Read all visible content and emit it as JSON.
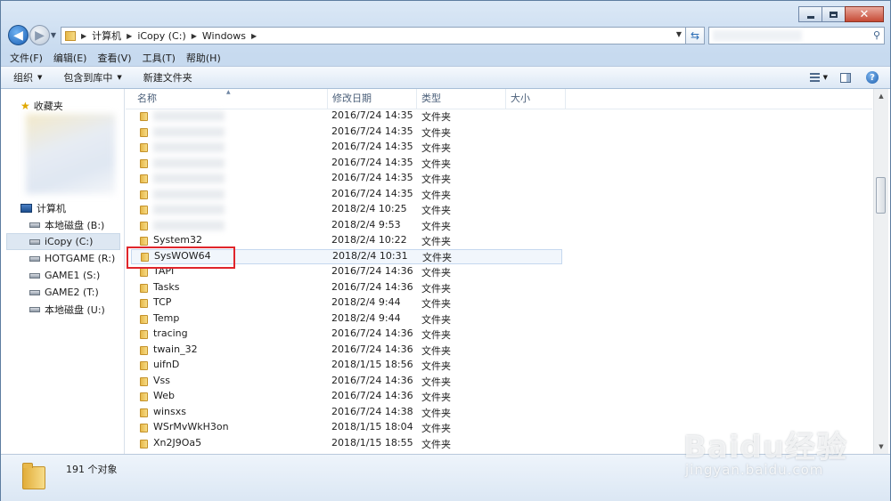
{
  "address": {
    "crumbs": [
      "计算机",
      "iCopy (C:)",
      "Windows"
    ]
  },
  "menu": [
    "文件(F)",
    "编辑(E)",
    "查看(V)",
    "工具(T)",
    "帮助(H)"
  ],
  "commands": {
    "organize": "组织",
    "include_library": "包含到库中",
    "new_folder": "新建文件夹"
  },
  "sidebar": {
    "favorites": "收藏夹",
    "computer": "计算机",
    "drives": [
      "本地磁盘 (B:)",
      "iCopy (C:)",
      "HOTGAME (R:)",
      "GAME1 (S:)",
      "GAME2 (T:)",
      "本地磁盘 (U:)"
    ],
    "selected_drive": "iCopy (C:)"
  },
  "columns": {
    "name": "名称",
    "date": "修改日期",
    "type": "类型",
    "size": "大小"
  },
  "files": [
    {
      "name": "",
      "date": "2016/7/24 14:35",
      "type": "文件夹"
    },
    {
      "name": "",
      "date": "2016/7/24 14:35",
      "type": "文件夹"
    },
    {
      "name": "",
      "date": "2016/7/24 14:35",
      "type": "文件夹"
    },
    {
      "name": "",
      "date": "2016/7/24 14:35",
      "type": "文件夹"
    },
    {
      "name": "",
      "date": "2016/7/24 14:35",
      "type": "文件夹"
    },
    {
      "name": "",
      "date": "2016/7/24 14:35",
      "type": "文件夹"
    },
    {
      "name": "",
      "date": "2018/2/4 10:25",
      "type": "文件夹"
    },
    {
      "name": "",
      "date": "2018/2/4 9:53",
      "type": "文件夹"
    },
    {
      "name": "System32",
      "date": "2018/2/4 10:22",
      "type": "文件夹"
    },
    {
      "name": "SysWOW64",
      "date": "2018/2/4 10:31",
      "type": "文件夹",
      "selected": true
    },
    {
      "name": "TAPI",
      "date": "2016/7/24 14:36",
      "type": "文件夹"
    },
    {
      "name": "Tasks",
      "date": "2016/7/24 14:36",
      "type": "文件夹"
    },
    {
      "name": "TCP",
      "date": "2018/2/4 9:44",
      "type": "文件夹"
    },
    {
      "name": "Temp",
      "date": "2018/2/4 9:44",
      "type": "文件夹"
    },
    {
      "name": "tracing",
      "date": "2016/7/24 14:36",
      "type": "文件夹"
    },
    {
      "name": "twain_32",
      "date": "2016/7/24 14:36",
      "type": "文件夹"
    },
    {
      "name": "uifnD",
      "date": "2018/1/15 18:56",
      "type": "文件夹"
    },
    {
      "name": "Vss",
      "date": "2016/7/24 14:36",
      "type": "文件夹"
    },
    {
      "name": "Web",
      "date": "2016/7/24 14:36",
      "type": "文件夹"
    },
    {
      "name": "winsxs",
      "date": "2016/7/24 14:38",
      "type": "文件夹"
    },
    {
      "name": "WSrMvWkH3on",
      "date": "2018/1/15 18:04",
      "type": "文件夹"
    },
    {
      "name": "Xn2J9Oa5",
      "date": "2018/1/15 18:55",
      "type": "文件夹"
    }
  ],
  "status": {
    "count": "191 个对象"
  },
  "watermark": {
    "brand": "Baidu经验",
    "url": "jingyan.baidu.com"
  },
  "colors": {
    "highlight_box": "#e0252b",
    "selection": "#f1f6fc"
  }
}
